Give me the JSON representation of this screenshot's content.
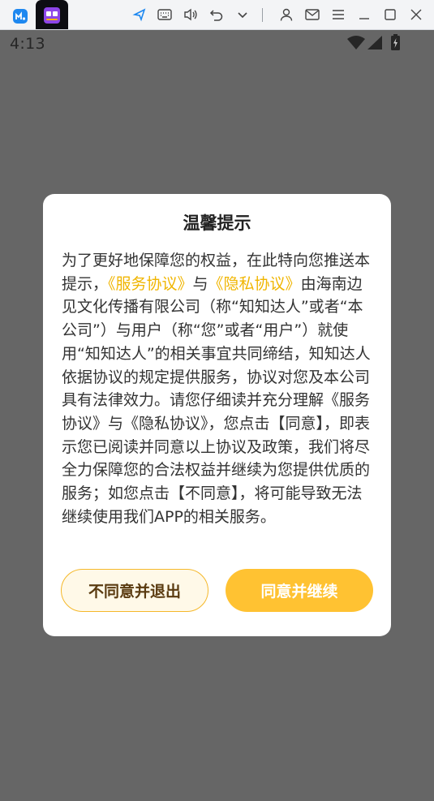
{
  "toolbar": {
    "icons": [
      "app-home-icon",
      "app-tab-icon",
      "pointer-icon",
      "keyboard-icon",
      "volume-icon",
      "undo-icon",
      "chevron-down-icon",
      "user-icon",
      "mail-icon",
      "menu-icon",
      "minimize-icon",
      "maximize-icon",
      "close-icon"
    ]
  },
  "statusbar": {
    "time": "4:13",
    "icons": [
      "wifi-icon",
      "signal-icon",
      "battery-icon"
    ]
  },
  "dialog": {
    "title": "温馨提示",
    "body_intro": "为了更好地保障您的权益，在此特向您推送本提示，",
    "link_service": "《服务协议》",
    "body_and": "与",
    "link_privacy": "《隐私协议》",
    "body_rest": "由海南边见文化传播有限公司（称“知知达人”或者“本公司”）与用户（称“您”或者“用户”）就使用“知知达人”的相关事宜共同缔结，知知达人依据协议的规定提供服务，协议对您及本公司具有法律效力。请您仔细读并充分理解《服务协议》与《隐私协议》，您点击【同意】，即表示您已阅读并同意以上协议及政策，我们将尽全力保障您的合法权益并继续为您提供优质的服务；如您点击【不同意】，将可能导致无法继续使用我们APP的相关服务。",
    "decline_label": "不同意并退出",
    "agree_label": "同意并继续"
  },
  "colors": {
    "overlay": "#666666",
    "accent": "#ffc232",
    "link": "#f0b500",
    "decline_bg": "#fff9e8",
    "decline_border": "#f5b82a"
  }
}
